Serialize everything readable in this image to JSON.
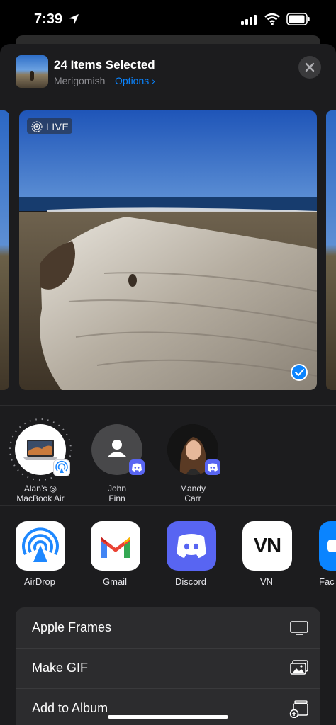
{
  "status_bar": {
    "time": "7:39",
    "icons": [
      "location-arrow-icon",
      "cellular-signal-icon",
      "wifi-icon",
      "battery-icon"
    ]
  },
  "header": {
    "title": "24 Items Selected",
    "subtitle": "Merigomish",
    "options_label": "Options ›",
    "accent_color": "#0a84ff"
  },
  "photo": {
    "live_label": "LIVE",
    "selected": true
  },
  "people": [
    {
      "label_line1": "Alan’s ◎",
      "label_line2": "MacBook Air",
      "badge": "airdrop-icon"
    },
    {
      "label_line1": "John",
      "label_line2": "Finn",
      "badge": "discord-icon"
    },
    {
      "label_line1": "Mandy",
      "label_line2": "Carr",
      "badge": "discord-icon"
    }
  ],
  "apps": [
    {
      "label": "AirDrop",
      "icon": "airdrop-icon"
    },
    {
      "label": "Gmail",
      "icon": "gmail-icon"
    },
    {
      "label": "Discord",
      "icon": "discord-icon"
    },
    {
      "label": "VN",
      "icon": "vn-icon",
      "icon_text": "VN"
    },
    {
      "label": "Fac",
      "icon": "facetime-icon"
    }
  ],
  "actions": [
    {
      "label": "Apple Frames",
      "icon": "display-icon"
    },
    {
      "label": "Make GIF",
      "icon": "photos-stack-icon"
    },
    {
      "label": "Add to Album",
      "icon": "add-to-album-icon"
    }
  ]
}
